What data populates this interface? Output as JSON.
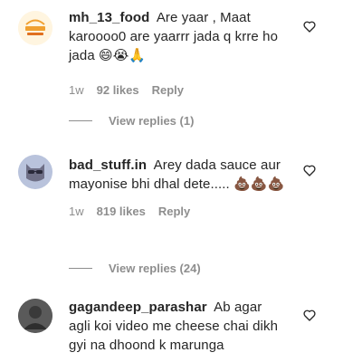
{
  "comments": [
    {
      "username": "mh_13_food",
      "text": "Are yaar , Maat karoooo0 are yaarrr jada q krre ho jada",
      "emojis": "😄😭🙏",
      "time": "1w",
      "likes": "92 likes",
      "reply": "Reply",
      "view_replies": "View replies (1)",
      "avatar_icon": "food-logo-avatar"
    },
    {
      "username": "bad_stuff.in",
      "text": "Arey dada sauce aur mayonise bhi dhal dete.....",
      "emojis": "💩💩💩",
      "time": "1w",
      "likes": "819 likes",
      "reply": "Reply",
      "view_replies": "View replies (24)",
      "avatar_icon": "cat-sunglasses-avatar"
    },
    {
      "username": "gagandeep_parashar",
      "text": "Ab agar agli koi video me cheese chai dikh gyi na dhoond k marunga",
      "avatar_icon": "dark-photo-avatar"
    }
  ],
  "colors": {
    "text": "#262626",
    "muted": "#8e8e8e",
    "background": "#ffffff"
  }
}
